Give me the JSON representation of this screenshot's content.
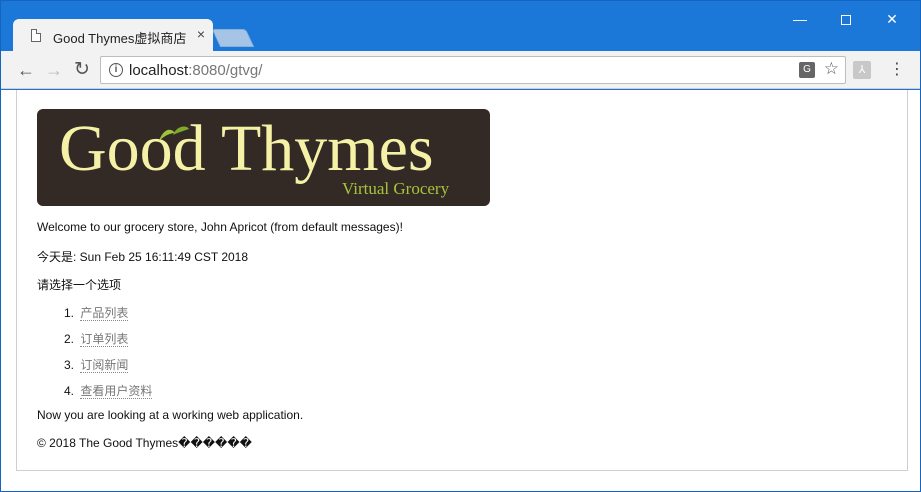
{
  "browser": {
    "tab_title": "Good Thymes虚拟商店",
    "tab_close": "×",
    "url_host": "localhost",
    "url_path": ":8080/gtvg/",
    "window_controls": {
      "minimize": "—",
      "close": "✕"
    }
  },
  "page": {
    "logo": {
      "main": "Good Thymes",
      "sub": "Virtual Grocery"
    },
    "welcome": "Welcome to our grocery store, John Apricot (from default messages)!",
    "date": "今天是: Sun Feb 25 16:11:49 CST 2018",
    "choose": "请选择一个选项",
    "options": [
      {
        "num": "1.",
        "label": "产品列表"
      },
      {
        "num": "2.",
        "label": "订单列表"
      },
      {
        "num": "3.",
        "label": "订阅新闻"
      },
      {
        "num": "4.",
        "label": "查看用户资料"
      }
    ],
    "working": "Now you are looking at a working web application.",
    "footer": "© 2018 The Good Thymes������"
  },
  "colors": {
    "titlebar": "#1b78d8",
    "logo_bg": "#332a25",
    "logo_text": "#f5f1a6",
    "logo_sub": "#a8c43b",
    "link": "#777777"
  }
}
